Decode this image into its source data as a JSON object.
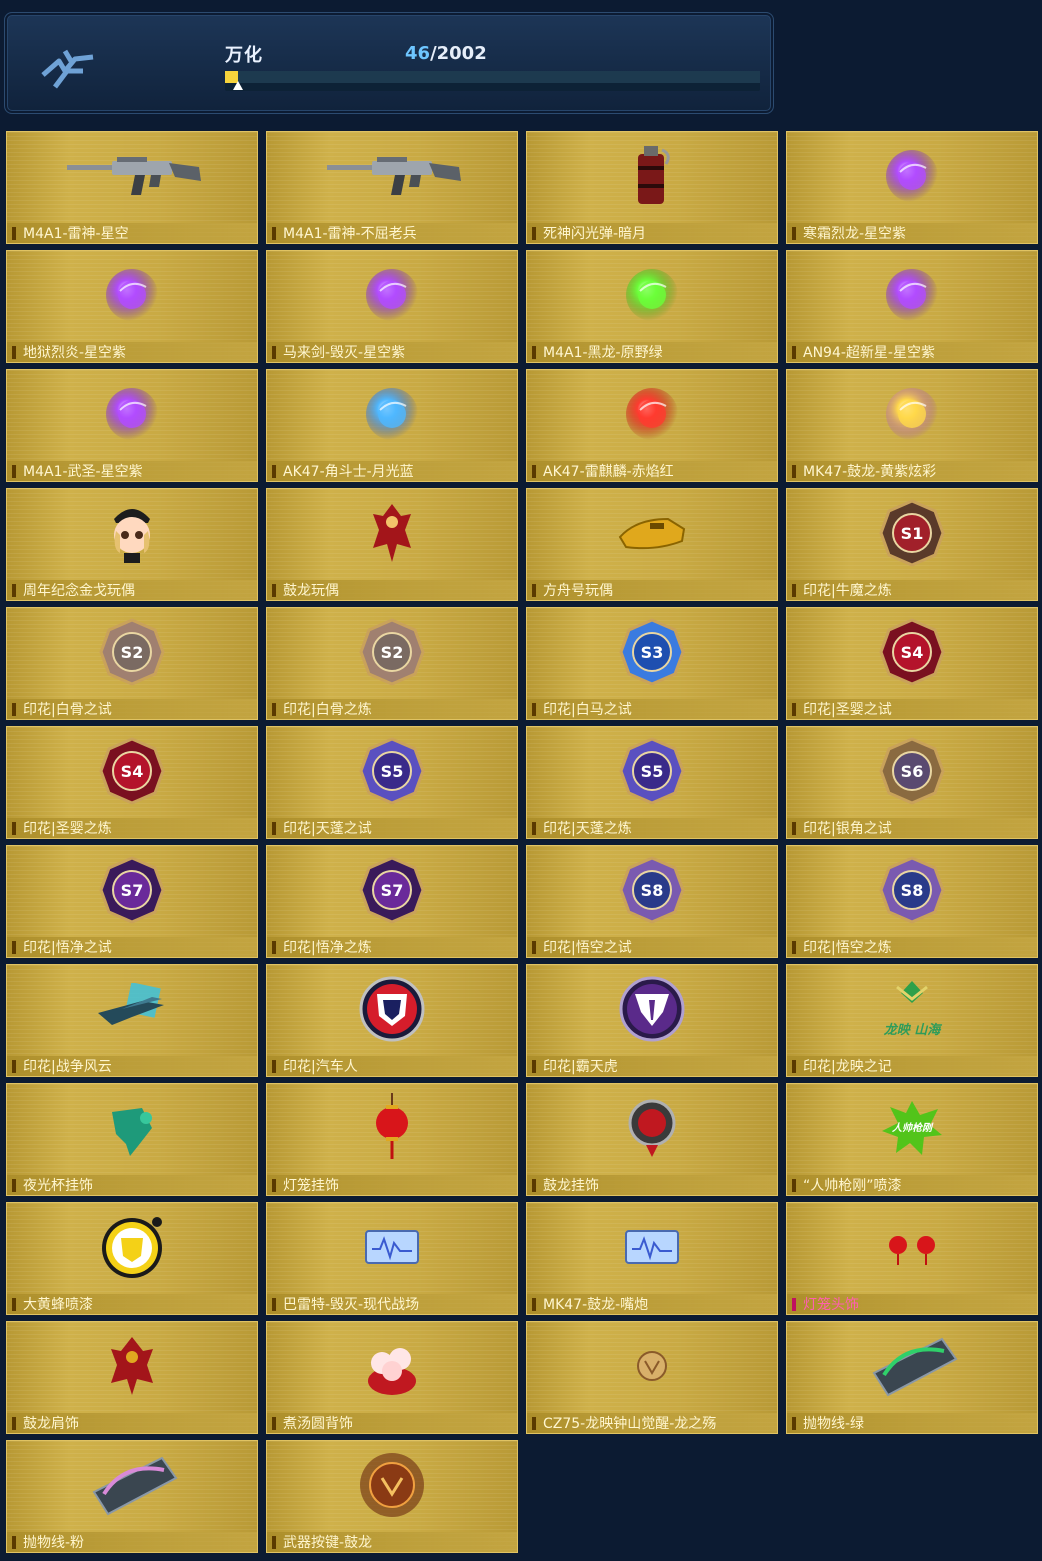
{
  "header": {
    "player_name": "万化",
    "progress_current": "46",
    "progress_total": "/2002",
    "progress_fraction": 0.023
  },
  "items": [
    {
      "label": "M4A1-雷神-星空",
      "icon": "rifle-icon"
    },
    {
      "label": "M4A1-雷神-不屈老兵",
      "icon": "rifle-icon"
    },
    {
      "label": "死神闪光弹-暗月",
      "icon": "grenade-icon"
    },
    {
      "label": "寒霜烈龙-星空紫",
      "icon": "purple-orb-icon"
    },
    {
      "label": "地狱烈炎-星空紫",
      "icon": "purple-orb-icon"
    },
    {
      "label": "马来剑-毁灭-星空紫",
      "icon": "purple-orb-icon"
    },
    {
      "label": "M4A1-黑龙-原野绿",
      "icon": "green-orb-icon"
    },
    {
      "label": "AN94-超新星-星空紫",
      "icon": "purple-orb-icon"
    },
    {
      "label": "M4A1-武圣-星空紫",
      "icon": "purple-orb-icon"
    },
    {
      "label": "AK47-角斗士-月光蓝",
      "icon": "blue-orb-icon"
    },
    {
      "label": "AK47-雷麒麟-赤焰红",
      "icon": "red-orb-icon"
    },
    {
      "label": "MK47-鼓龙-黄紫炫彩",
      "icon": "yellow-purple-orb-icon"
    },
    {
      "label": "周年纪念金戈玩偶",
      "icon": "doll-icon"
    },
    {
      "label": "鼓龙玩偶",
      "icon": "dragon-doll-icon"
    },
    {
      "label": "方舟号玩偶",
      "icon": "ship-doll-icon"
    },
    {
      "label": "印花|牛魔之炼",
      "icon": "season-badge-icon",
      "badge": "S1"
    },
    {
      "label": "印花|白骨之试",
      "icon": "season-badge-icon",
      "badge": "S2"
    },
    {
      "label": "印花|白骨之炼",
      "icon": "season-badge-icon",
      "badge": "S2"
    },
    {
      "label": "印花|白马之试",
      "icon": "season-badge-icon",
      "badge": "S3"
    },
    {
      "label": "印花|圣婴之试",
      "icon": "season-badge-icon",
      "badge": "S4"
    },
    {
      "label": "印花|圣婴之炼",
      "icon": "season-badge-icon",
      "badge": "S4"
    },
    {
      "label": "印花|天蓬之试",
      "icon": "season-badge-icon",
      "badge": "S5"
    },
    {
      "label": "印花|天蓬之炼",
      "icon": "season-badge-icon",
      "badge": "S5"
    },
    {
      "label": "印花|银角之试",
      "icon": "season-badge-icon",
      "badge": "S6"
    },
    {
      "label": "印花|悟净之试",
      "icon": "season-badge-icon",
      "badge": "S7"
    },
    {
      "label": "印花|悟净之炼",
      "icon": "season-badge-icon",
      "badge": "S7"
    },
    {
      "label": "印花|悟空之试",
      "icon": "season-badge-icon",
      "badge": "S8"
    },
    {
      "label": "印花|悟空之炼",
      "icon": "season-badge-icon",
      "badge": "S8"
    },
    {
      "label": "印花|战争风云",
      "icon": "war-emblem-icon"
    },
    {
      "label": "印花|汽车人",
      "icon": "autobot-icon"
    },
    {
      "label": "印花|霸天虎",
      "icon": "decepticon-icon"
    },
    {
      "label": "印花|龙映之记",
      "icon": "dragon-mark-icon",
      "art_text": "龙映 山海"
    },
    {
      "label": "夜光杯挂饰",
      "icon": "cup-charm-icon"
    },
    {
      "label": "灯笼挂饰",
      "icon": "lantern-icon"
    },
    {
      "label": "鼓龙挂饰",
      "icon": "dragon-charm-icon"
    },
    {
      "label": "“人帅枪刚”喷漆",
      "icon": "spray-icon",
      "art_text": "人帅枪刚"
    },
    {
      "label": "大黄蜂喷漆",
      "icon": "bumblebee-spray-icon"
    },
    {
      "label": "巴雷特-毁灭-现代战场",
      "icon": "card-icon"
    },
    {
      "label": "MK47-鼓龙-嘴炮",
      "icon": "card-icon"
    },
    {
      "label": "灯笼头饰",
      "icon": "lantern-headwear-icon",
      "highlight": "pink"
    },
    {
      "label": "鼓龙肩饰",
      "icon": "dragon-shoulder-icon"
    },
    {
      "label": "煮汤圆背饰",
      "icon": "dumpling-backpack-icon"
    },
    {
      "label": "CZ75-龙映钟山觉醒-龙之殇",
      "icon": "small-emblem-icon"
    },
    {
      "label": "抛物线-绿",
      "icon": "trajectory-green-icon"
    },
    {
      "label": "抛物线-粉",
      "icon": "trajectory-pink-icon"
    },
    {
      "label": "武器按键-鼓龙",
      "icon": "weapon-key-icon"
    }
  ],
  "colors": {
    "tile_gold": "#c9aa44",
    "page_bg": "#0c1b32",
    "progress_fill": "#f6d33c",
    "count_accent": "#6ec6ff",
    "highlight_pink": "#ff5fb0"
  }
}
